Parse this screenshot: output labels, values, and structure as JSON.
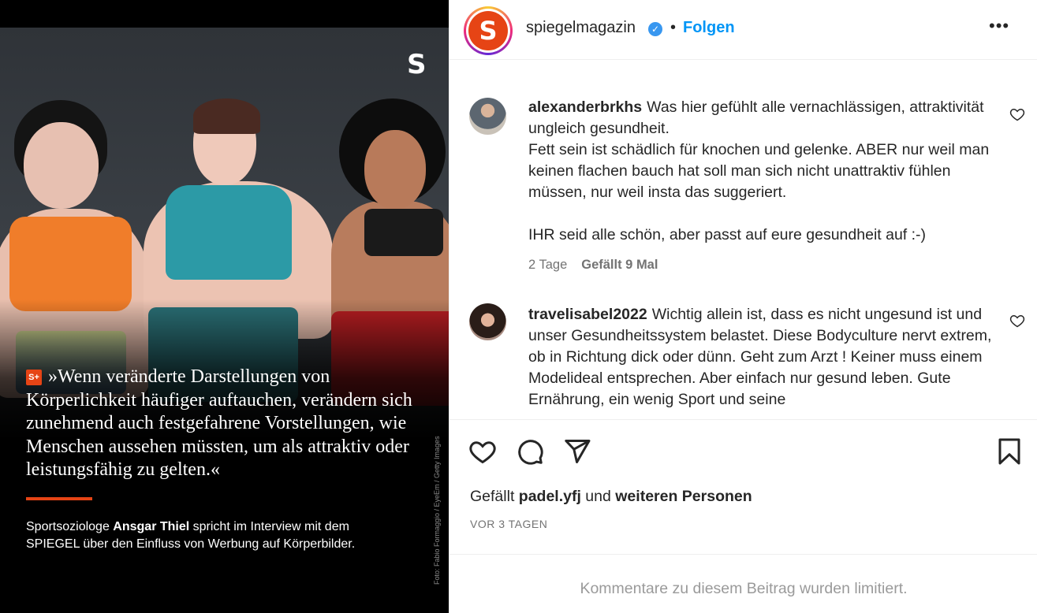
{
  "post_image": {
    "brand_mark": "S",
    "quote_badge": "S+",
    "quote": "»Wenn veränderte Darstellungen von Körperlichkeit häufiger auftauchen, verändern sich zunehmend auch festgefahrene Vorstellungen, wie Menschen aussehen müssten, um als attraktiv oder leistungsfähig zu gelten.«",
    "caption_prefix": "Sportsoziologe ",
    "caption_name": "Ansgar Thiel",
    "caption_suffix": " spricht im Interview mit dem SPIEGEL über den Einfluss von Werbung auf Körperbilder.",
    "photo_credit": "Foto: Fabio Formaggio / EyeEm / Getty Images",
    "accent_color": "#e64415"
  },
  "header": {
    "avatar_letter": "S",
    "username": "spiegelmagazin",
    "verified_icon": "verified-badge-icon",
    "separator": "•",
    "follow_label": "Folgen",
    "more_icon": "more-options-icon",
    "more_label": "•••"
  },
  "comments": [
    {
      "user": "alexanderbrkhs",
      "text": "Was hier gefühlt alle vernachlässigen, attraktivität ungleich gesundheit.\nFett sein ist schädlich für knochen und gelenke. ABER nur weil man keinen flachen bauch hat soll man sich nicht unattraktiv fühlen müssen, nur weil insta das suggeriert.\n\nIHR seid alle schön, aber passt auf eure gesundheit auf :-)",
      "age": "2 Tage",
      "likes": "Gefällt 9 Mal"
    },
    {
      "user": "travelisabel2022",
      "text": "Wichtig allein ist, dass es nicht ungesund ist und unser Gesundheitssystem belastet. Diese Bodyculture nervt extrem, ob in Richtung dick oder dünn. Geht zum Arzt ! Keiner muss einem Modelideal entsprechen. Aber einfach nur gesund leben. Gute Ernährung, ein wenig Sport und seine"
    }
  ],
  "actions": {
    "like_icon": "heart-icon",
    "comment_icon": "comment-icon",
    "share_icon": "share-icon",
    "save_icon": "bookmark-icon",
    "likes_prefix": "Gefällt ",
    "likes_user": "padel.yfj",
    "likes_middle": " und ",
    "likes_others": "weiteren Personen",
    "posted": "VOR 3 TAGEN"
  },
  "footer": {
    "comments_limited": "Kommentare zu diesem Beitrag wurden limitiert."
  }
}
